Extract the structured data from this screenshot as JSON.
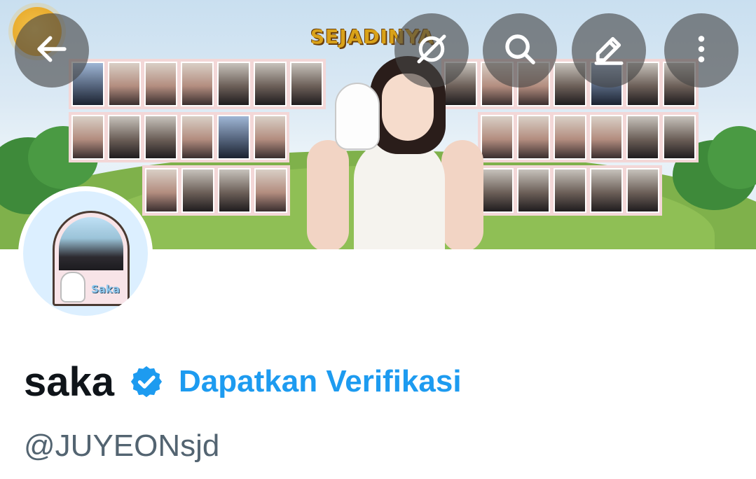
{
  "banner": {
    "title": "SEJADINYA",
    "avatar_label": "Saka"
  },
  "header": {
    "back_icon": "arrow-left-icon",
    "grok_icon": "grok-icon",
    "search_icon": "search-icon",
    "edit_icon": "pencil-icon",
    "more_icon": "more-vertical-icon"
  },
  "profile": {
    "display_name": "saka",
    "verify_label": "Dapatkan Verifikasi",
    "handle": "@JUYEONsjd"
  },
  "colors": {
    "accent": "#1d9bf0",
    "name": "#0f1419",
    "handle": "#536471"
  }
}
